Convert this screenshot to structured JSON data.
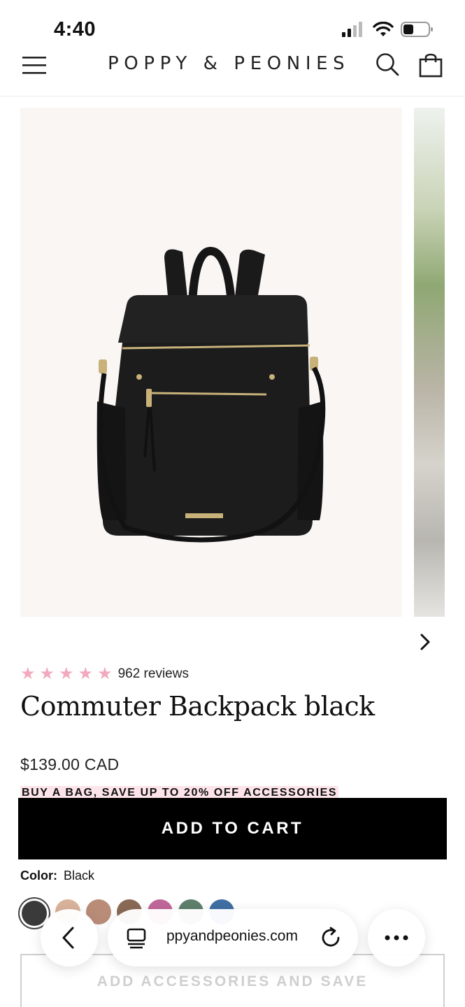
{
  "status_bar": {
    "time": "4:40"
  },
  "header": {
    "brand": "POPPY & PEONIES",
    "menu_icon": "hamburger-icon",
    "search_icon": "search-icon",
    "cart_icon": "shopping-bag-icon"
  },
  "gallery": {
    "main_image": "black-backpack-product-photo",
    "next_icon": "chevron-right-icon"
  },
  "product": {
    "rating": 5,
    "reviews": "962 reviews",
    "title": "Commuter Backpack black",
    "price": "$139.00 CAD",
    "promo": "BUY A BAG, SAVE UP TO 20% OFF ACCESSORIES",
    "add_to_cart": "ADD TO CART",
    "color_label": "Color:",
    "color_value": "Black",
    "swatch_colors": [
      "#3a3a3a",
      "#d9b29a",
      "#b98c78",
      "#8a6a55",
      "#c0679a",
      "#5e7f6c",
      "#3f6fa3"
    ],
    "accessories": "ADD ACCESSORIES AND SAVE"
  },
  "browser": {
    "url": "poppyandpeonies.com",
    "url_visible": "ppyandpeonies.com",
    "back_icon": "chevron-left-icon",
    "tabs_icon": "tabs-icon",
    "reload_icon": "reload-icon",
    "more_icon": "more-icon"
  },
  "colors": {
    "accent_pink": "#f2a9be",
    "promo_bg": "#fde4ea",
    "button_bg": "#000000"
  }
}
